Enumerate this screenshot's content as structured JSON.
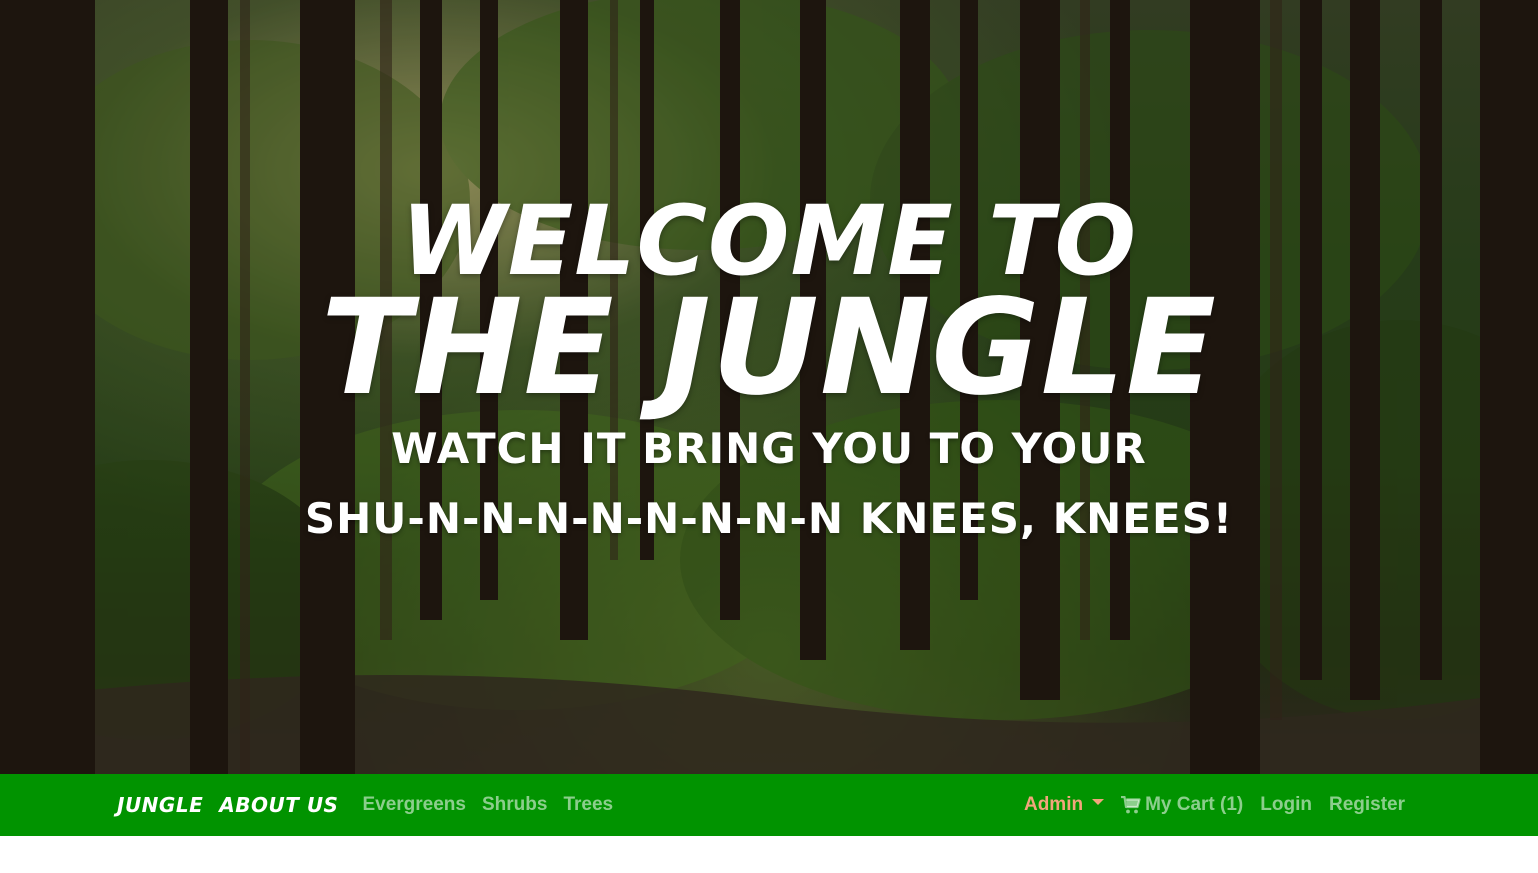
{
  "hero": {
    "title_line1": "WELCOME TO",
    "title_line2": "THE JUNGLE",
    "subtitle_line1": "WATCH IT BRING YOU TO YOUR",
    "subtitle_line2": "SHU-N-N-N-N-N-N-N-N KNEES, KNEES!",
    "background_image": "forest-photo"
  },
  "navbar": {
    "background_color": "#019300",
    "brand": "JUNGLE",
    "about": "ABOUT US",
    "categories": [
      {
        "label": "Evergreens"
      },
      {
        "label": "Shrubs"
      },
      {
        "label": "Trees"
      }
    ],
    "admin_label": "Admin",
    "admin_color": "#f2a57c",
    "cart_icon": "shopping-cart-icon",
    "cart_label": "My Cart (1)",
    "login_label": "Login",
    "register_label": "Register"
  }
}
